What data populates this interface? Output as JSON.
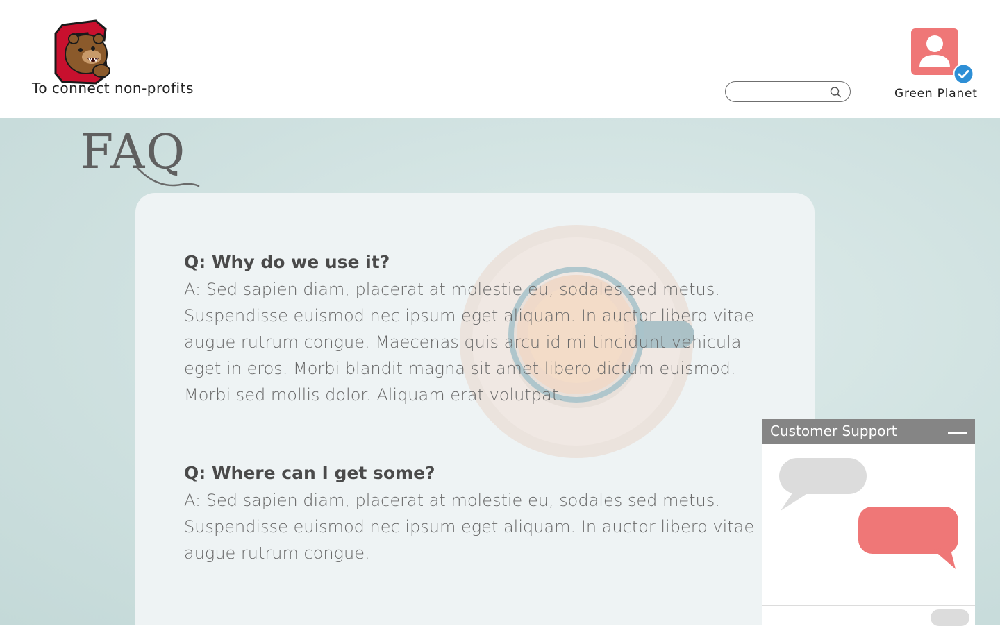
{
  "header": {
    "tagline": "To connect non-profits",
    "search": {
      "placeholder": "",
      "value": ""
    },
    "profile": {
      "name": "Green Planet",
      "verified": true
    }
  },
  "faq": {
    "title": "FAQ",
    "items": [
      {
        "question": "Q: Why do we use it?",
        "answer": "A: Sed sapien diam, placerat at molestie eu, sodales sed metus. Suspendisse euismod nec ipsum eget aliquam. In auctor libero vitae augue rutrum congue. Maecenas quis arcu id mi tincidunt vehicula eget in eros. Morbi blandit magna sit amet libero dictum euismod. Morbi sed mollis dolor. Aliquam erat volutpat."
      },
      {
        "question": "Q: Where can I get some?",
        "answer": "A: Sed sapien diam, placerat at molestie eu, sodales sed metus. Suspendisse euismod nec ipsum eget aliquam. In auctor libero vitae augue rutrum congue."
      }
    ]
  },
  "support": {
    "title": "Customer Support"
  },
  "icons": {
    "search": "search-icon",
    "verified": "verified-check-icon",
    "minimize": "minimize-icon",
    "profile": "user-avatar-icon"
  },
  "colors": {
    "accent": "#ef7777",
    "verified": "#2e8fd6",
    "support_header": "#858585",
    "background": "#cfe1e0"
  }
}
